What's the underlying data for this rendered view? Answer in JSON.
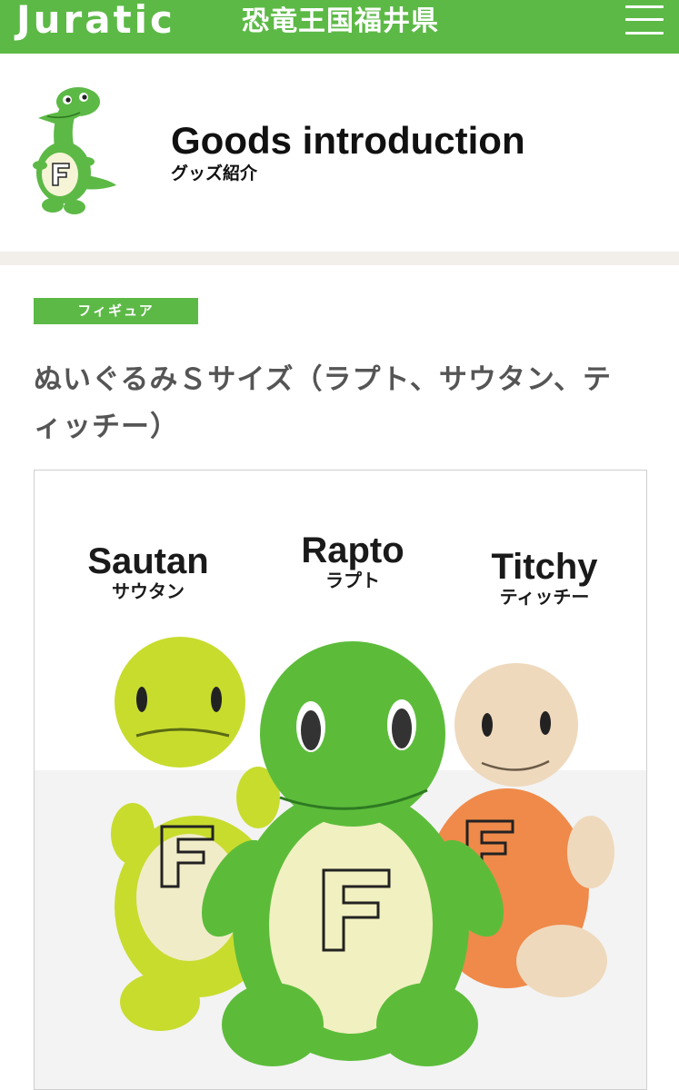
{
  "header": {
    "logo_text": "Juratic",
    "logo_subtitle": "恐竜王国福井県",
    "menu_icon": "hamburger-menu-icon",
    "brand_color": "#5cb946"
  },
  "page": {
    "title": "Goods introduction",
    "title_ja": "グッズ紹介",
    "mascot_icon": "dinosaur-mascot-icon"
  },
  "item": {
    "category": "フィギュア",
    "title": "ぬいぐるみＳサイズ（ラプト、サウタン、ティッチー）",
    "characters": [
      {
        "name_en": "Sautan",
        "name_ja": "サウタン",
        "color": "#c8dc2e"
      },
      {
        "name_en": "Rapto",
        "name_ja": "ラプト",
        "color": "#5cbc3a"
      },
      {
        "name_en": "Titchy",
        "name_ja": "ティッチー",
        "color": "#efd9bd"
      }
    ]
  }
}
